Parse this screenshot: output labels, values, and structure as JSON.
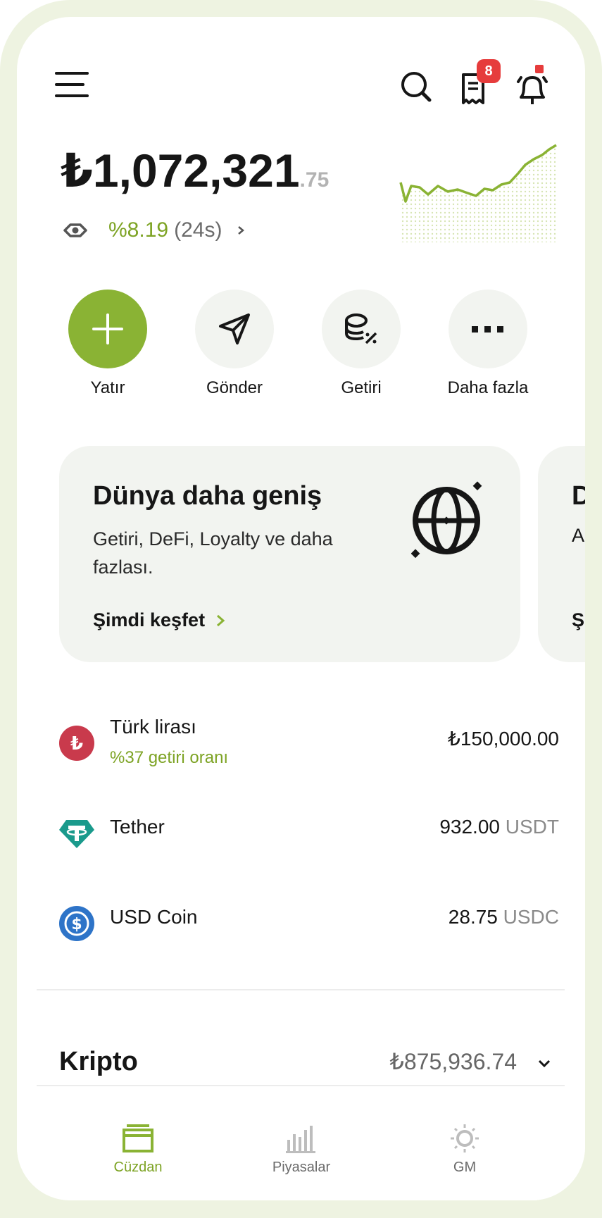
{
  "header": {
    "notifications_badge": "8"
  },
  "balance": {
    "main": "₺1,072,321",
    "cents": ".75",
    "change_pct": "%8.19",
    "change_period": "(24s)"
  },
  "actions": [
    {
      "label": "Yatır"
    },
    {
      "label": "Gönder"
    },
    {
      "label": "Getiri"
    },
    {
      "label": "Daha fazla"
    }
  ],
  "promo": {
    "title": "Dünya daha geniş",
    "description": "Getiri, DeFi, Loyalty ve daha fazlası.",
    "link": "Şimdi keşfet",
    "next_card_title": "D",
    "next_card_desc": "A",
    "next_card_link": "Ş"
  },
  "assets": [
    {
      "name": "Türk lirası",
      "sub": "%37 getiri oranı",
      "amount": "₺150,000.00",
      "unit": ""
    },
    {
      "name": "Tether",
      "sub": "",
      "amount": "932.00",
      "unit": "USDT"
    },
    {
      "name": "USD Coin",
      "sub": "",
      "amount": "28.75",
      "unit": "USDC"
    }
  ],
  "kripto": {
    "title": "Kripto",
    "value": "₺875,936.74"
  },
  "bottom_nav": [
    {
      "label": "Cüzdan"
    },
    {
      "label": "Piyasalar"
    },
    {
      "label": "GM"
    }
  ],
  "colors": {
    "accent": "#8ab334",
    "accent_text": "#7da324",
    "badge": "#e63c3c",
    "card_bg": "#f2f4f0",
    "frame": "#eef3e1"
  }
}
